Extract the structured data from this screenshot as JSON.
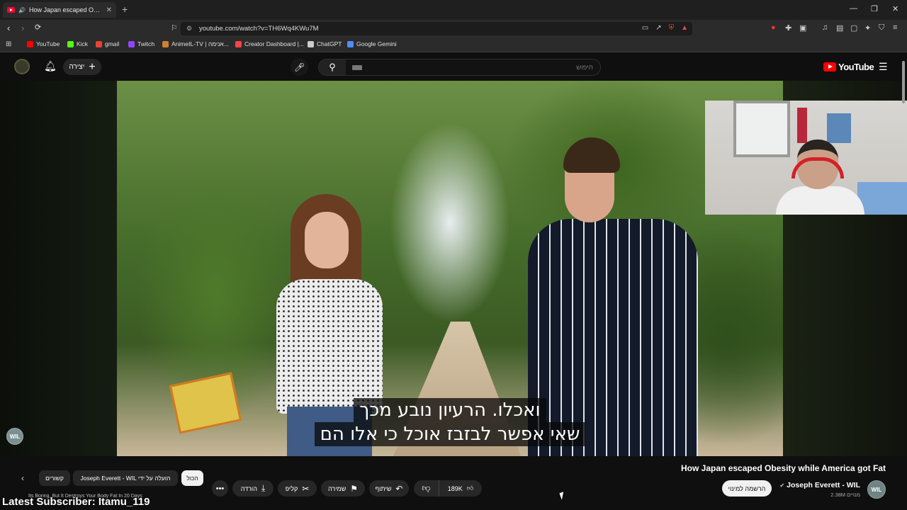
{
  "browser": {
    "tab_title": "How Japan escaped Obesity",
    "tab_close": "✕",
    "new_tab": "+",
    "url": "youtube.com/watch?v=TH6Wq4KWu7M",
    "window_controls": [
      "—",
      "❐",
      "✕"
    ]
  },
  "bookmarks": [
    {
      "label": "YouTube",
      "color": "#ff0000"
    },
    {
      "label": "Kick",
      "color": "#53fc18"
    },
    {
      "label": "gmail",
      "color": "#ea4335"
    },
    {
      "label": "Twitch",
      "color": "#9146ff"
    },
    {
      "label": "AnimeIL-TV | אנימה...",
      "color": "#d08030"
    },
    {
      "label": "Creator Dashboard |...",
      "color": "#ff4444"
    },
    {
      "label": "ChatGPT",
      "color": "#cccccc"
    },
    {
      "label": "Google Gemini",
      "color": "#4f8cff"
    }
  ],
  "youtube_header": {
    "create_label": "יצירה",
    "search_placeholder": "חיפוש",
    "logo_text": "YouTube"
  },
  "video": {
    "subtitle_line1": "ואכלו.  הרעיון נובע מכך",
    "subtitle_line2": "שאי אפשר לבזבז אוכל כי אלו הם",
    "channel_badge": "WIL"
  },
  "below": {
    "title": "How Japan escaped Obesity while America got Fat",
    "channel_name": "Joseph Everett - WIL",
    "subscribers": "2.38M מנויים",
    "subscribe_label": "הרשמה למינוי",
    "likes": "189K",
    "share_label": "שיתוף",
    "save_label": "שמירה",
    "clip_label": "קליפ",
    "download_label": "הורדה",
    "more_label": "•••",
    "chips": [
      "הכול",
      "Joseph Everett - WIL הועלה על ידי",
      "קשורים"
    ],
    "overlay_text": "Latest Subscriber: Itamu_119",
    "recommendation_text": "Its Boring, But It Destroys Your Body Fat In 20 Days"
  }
}
